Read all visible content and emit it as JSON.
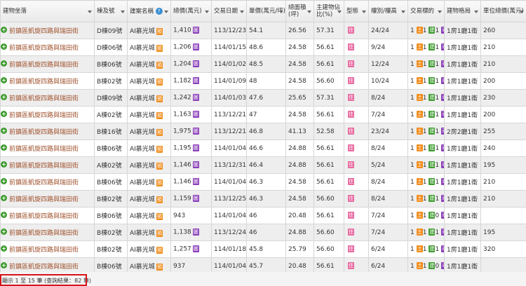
{
  "headers": {
    "address": "建物坐落",
    "unit": "棟及號",
    "project": "建案名稱",
    "project_help": "?",
    "price": "總價(萬元)",
    "date": "交易日期",
    "unit_price": "單價(萬元/坪)",
    "area": "總面積(坪)",
    "main_ratio": "主建物佔比(%)",
    "type": "型態",
    "floor": "樓別/樓高",
    "trade": "交易標的",
    "layout": "建物格局",
    "parking": "車位總價(萬元)"
  },
  "rows": [
    {
      "address": "前鎮區凱旋四路與瑞田街",
      "unit": "D棟09號",
      "project": "AI慕光城",
      "badge": "預",
      "price": "1,410",
      "price_badge": "圖",
      "date": "113/12/23",
      "unit_price": "54.1",
      "area": "26.56",
      "ratio": "57.31",
      "type": "住",
      "floor": "24/24",
      "trade": [
        "1",
        "1",
        "1"
      ],
      "layout": "1房1廳1衛",
      "parking": "260"
    },
    {
      "address": "前鎮區凱旋四路與瑞田街",
      "unit": "D棟06號",
      "project": "AI慕光城",
      "badge": "預",
      "price": "1,206",
      "price_badge": "圖",
      "date": "114/01/15",
      "unit_price": "48.6",
      "area": "24.58",
      "ratio": "56.61",
      "type": "住",
      "floor": "9/24",
      "trade": [
        "1",
        "1",
        "1"
      ],
      "layout": "1房1廳1衛",
      "parking": "210"
    },
    {
      "address": "前鎮區凱旋四路與瑞田街",
      "unit": "B棟06號",
      "project": "AI慕光城",
      "badge": "預",
      "price": "1,204",
      "price_badge": "圖",
      "date": "114/01/02",
      "unit_price": "48.5",
      "area": "24.58",
      "ratio": "56.61",
      "type": "住",
      "floor": "12/24",
      "trade": [
        "1",
        "1",
        "1"
      ],
      "layout": "1房1廳1衛",
      "parking": "210"
    },
    {
      "address": "前鎮區凱旋四路與瑞田街",
      "unit": "B棟02號",
      "project": "AI慕光城",
      "badge": "預",
      "price": "1,182",
      "price_badge": "圖",
      "date": "114/01/09",
      "unit_price": "48",
      "area": "24.58",
      "ratio": "56.60",
      "type": "住",
      "floor": "10/24",
      "trade": [
        "1",
        "1",
        "1"
      ],
      "layout": "1房1廳1衛",
      "parking": "200"
    },
    {
      "address": "前鎮區凱旋四路與瑞田街",
      "unit": "D棟09號",
      "project": "AI慕光城",
      "badge": "預",
      "price": "1,242",
      "price_badge": "圖",
      "date": "114/01/03",
      "unit_price": "47.6",
      "area": "25.65",
      "ratio": "57.31",
      "type": "住",
      "floor": "8/24",
      "trade": [
        "1",
        "1",
        "1"
      ],
      "layout": "1房1廳1衛",
      "parking": "230"
    },
    {
      "address": "前鎮區凱旋四路與瑞田街",
      "unit": "A棟02號",
      "project": "AI慕光城",
      "badge": "預",
      "price": "1,163",
      "price_badge": "圖",
      "date": "113/12/21",
      "unit_price": "47",
      "area": "24.58",
      "ratio": "56.61",
      "type": "住",
      "floor": "7/24",
      "trade": [
        "1",
        "1",
        "1"
      ],
      "layout": "1房1廳1衛",
      "parking": "200"
    },
    {
      "address": "前鎮區凱旋四路與瑞田街",
      "unit": "B棟16號",
      "project": "AI慕光城",
      "badge": "預",
      "price": "1,975",
      "price_badge": "圖",
      "date": "113/12/21",
      "unit_price": "46.8",
      "area": "41.13",
      "ratio": "52.58",
      "type": "住",
      "floor": "23/24",
      "trade": [
        "1",
        "1",
        "1"
      ],
      "layout": "2房2廳1衛",
      "parking": "255"
    },
    {
      "address": "前鎮區凱旋四路與瑞田街",
      "unit": "B棟06號",
      "project": "AI慕光城",
      "badge": "預",
      "price": "1,195",
      "price_badge": "圖",
      "date": "114/01/04",
      "unit_price": "46.6",
      "area": "24.88",
      "ratio": "56.61",
      "type": "住",
      "floor": "8/24",
      "trade": [
        "1",
        "1",
        "1"
      ],
      "layout": "1房1廳1衛",
      "parking": "240"
    },
    {
      "address": "前鎮區凱旋四路與瑞田街",
      "unit": "A棟02號",
      "project": "AI慕光城",
      "badge": "預",
      "price": "1,146",
      "price_badge": "圖",
      "date": "113/12/31",
      "unit_price": "46.4",
      "area": "24.88",
      "ratio": "56.61",
      "type": "住",
      "floor": "5/24",
      "trade": [
        "1",
        "1",
        "1"
      ],
      "layout": "1房1廳1衛",
      "parking": "195"
    },
    {
      "address": "前鎮區凱旋四路與瑞田街",
      "unit": "B棟06號",
      "project": "AI慕光城",
      "badge": "預",
      "price": "1,146",
      "price_badge": "圖",
      "date": "114/01/04",
      "unit_price": "46.3",
      "area": "24.58",
      "ratio": "56.61",
      "type": "住",
      "floor": "8/24",
      "trade": [
        "1",
        "1",
        "1"
      ],
      "layout": "1房1廳1衛",
      "parking": "210"
    },
    {
      "address": "前鎮區凱旋四路與瑞田街",
      "unit": "B棟02號",
      "project": "AI慕光城",
      "badge": "預",
      "price": "1,159",
      "price_badge": "圖",
      "date": "113/12/25",
      "unit_price": "46.3",
      "area": "24.58",
      "ratio": "56.60",
      "type": "住",
      "floor": "8/24",
      "trade": [
        "1",
        "1",
        "1"
      ],
      "layout": "1房1廳1衛",
      "parking": "210"
    },
    {
      "address": "前鎮區凱旋四路與瑞田街",
      "unit": "B棟06號",
      "project": "AI慕光城",
      "badge": "預",
      "price": "943",
      "price_badge": "",
      "date": "114/01/04",
      "unit_price": "46",
      "area": "20.48",
      "ratio": "56.61",
      "type": "住",
      "floor": "7/24",
      "trade": [
        "1",
        "1",
        "0"
      ],
      "layout": "1房1廳1衛",
      "parking": ""
    },
    {
      "address": "前鎮區凱旋四路與瑞田街",
      "unit": "B棟02號",
      "project": "AI慕光城",
      "badge": "預",
      "price": "1,138",
      "price_badge": "圖",
      "date": "113/12/24",
      "unit_price": "46",
      "area": "24.88",
      "ratio": "56.60",
      "type": "住",
      "floor": "7/24",
      "trade": [
        "1",
        "1",
        "1"
      ],
      "layout": "1房1廳1衛",
      "parking": "195"
    },
    {
      "address": "前鎮區凱旋四路與瑞田街",
      "unit": "B棟02號",
      "project": "AI慕光城",
      "badge": "預",
      "price": "1,257",
      "price_badge": "圖",
      "date": "114/01/18",
      "unit_price": "45.8",
      "area": "25.79",
      "ratio": "56.60",
      "type": "住",
      "floor": "6/24",
      "trade": [
        "1",
        "1",
        "1"
      ],
      "layout": "1房1廳1衛",
      "parking": "320"
    },
    {
      "address": "前鎮區凱旋四路與瑞田街",
      "unit": "B棟06號",
      "project": "AI慕光城",
      "badge": "預",
      "price": "937",
      "price_badge": "",
      "date": "114/01/04",
      "unit_price": "45.7",
      "area": "20.48",
      "ratio": "56.61",
      "type": "住",
      "floor": "6/24",
      "trade": [
        "1",
        "1",
        "0"
      ],
      "layout": "1房1廳1衛",
      "parking": ""
    }
  ],
  "trade_colors": [
    "#f18d1c",
    "#3e9b2f",
    "#8a3db8"
  ],
  "footer": {
    "text": "顯示 1 至 15 筆 (查詢結果：82 筆)"
  }
}
